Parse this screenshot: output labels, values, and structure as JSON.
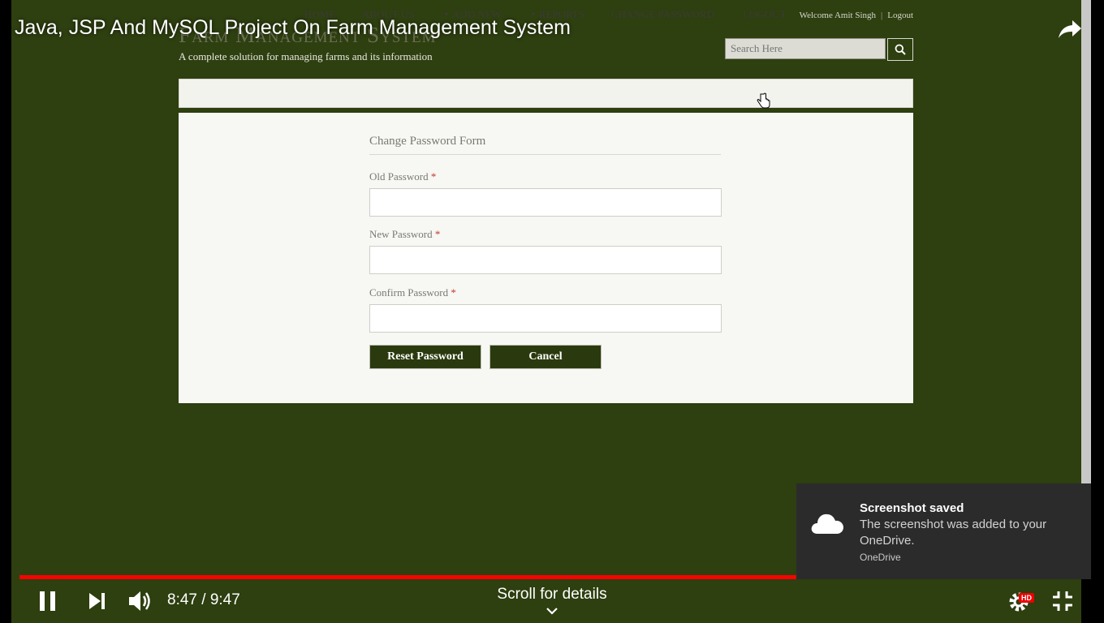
{
  "video": {
    "title": "Java, JSP And MySQL Project On Farm Management System",
    "current_time": "8:47",
    "duration": "9:47",
    "time_display": "8:47 / 9:47",
    "progress_fraction": 0.9,
    "scroll_hint": "Scroll for details",
    "hd_badge": "HD",
    "progress_color": "#ff0000"
  },
  "site": {
    "title": "Farm Management System",
    "tagline": "A complete solution for managing farms and its information",
    "welcome": "Welcome Amit Singh",
    "top_logout": "Logout",
    "search_placeholder": "Search Here",
    "theme_color": "#2e3f10"
  },
  "nav": {
    "items": [
      {
        "label": "HOME",
        "caret": false
      },
      {
        "label": "ABOUT US",
        "caret": false
      },
      {
        "label": "ADD NEW",
        "caret": true
      },
      {
        "label": "REPORTS",
        "caret": true
      },
      {
        "label": "CHANGE PASSWORD",
        "caret": false
      },
      {
        "label": "LOGOUT",
        "caret": false
      }
    ]
  },
  "form": {
    "title": "Change Password Form",
    "fields": [
      {
        "label": "Old Password",
        "required_mark": "*",
        "value": ""
      },
      {
        "label": "New Password",
        "required_mark": "*",
        "value": ""
      },
      {
        "label": "Confirm Password",
        "required_mark": "*",
        "value": ""
      }
    ],
    "submit_label": "Reset Password",
    "cancel_label": "Cancel"
  },
  "toast": {
    "title": "Screenshot saved",
    "body": "The screenshot was added to your OneDrive.",
    "source": "OneDrive"
  }
}
